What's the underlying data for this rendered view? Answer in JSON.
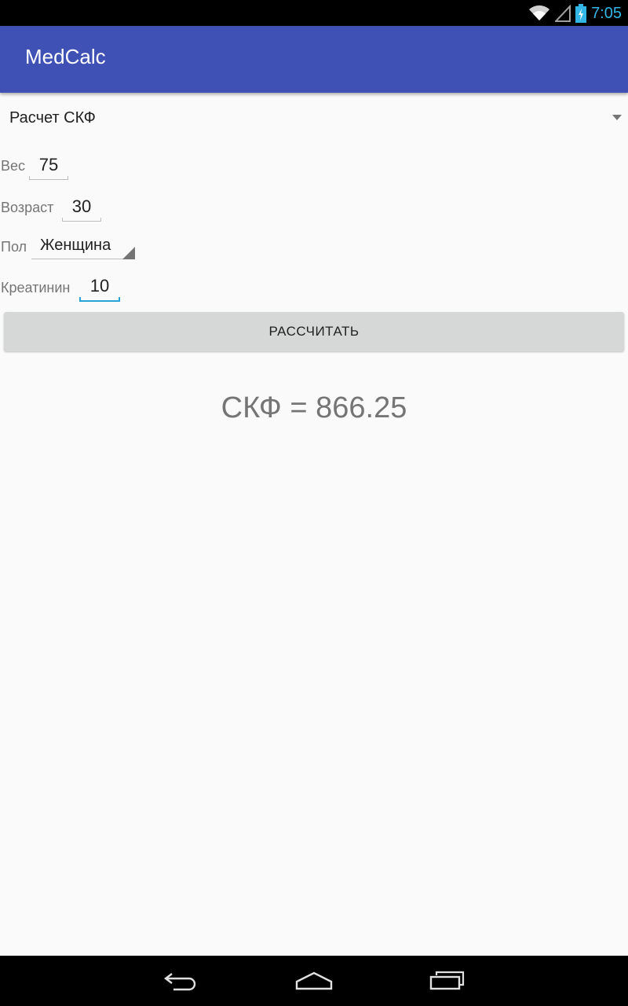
{
  "status_bar": {
    "time": "7:05",
    "icons": [
      "wifi-icon",
      "signal-icon",
      "battery-charging-icon"
    ],
    "accent_color": "#33b5e5"
  },
  "app_bar": {
    "title": "MedCalc",
    "color": "#3f51b5"
  },
  "calc_selector": {
    "selected": "Расчет СКФ"
  },
  "form": {
    "weight": {
      "label": "Вес",
      "value": "75"
    },
    "age": {
      "label": "Возраст",
      "value": "30"
    },
    "gender": {
      "label": "Пол",
      "selected": "Женщина"
    },
    "creatinine": {
      "label": "Креатинин",
      "value": "10",
      "focused": true
    }
  },
  "calculate_button": {
    "label": "РАССЧИТАТЬ"
  },
  "result": {
    "text": "СКФ = 866.25"
  },
  "nav_bar": {
    "buttons": [
      "back-icon",
      "home-icon",
      "recents-icon"
    ]
  }
}
